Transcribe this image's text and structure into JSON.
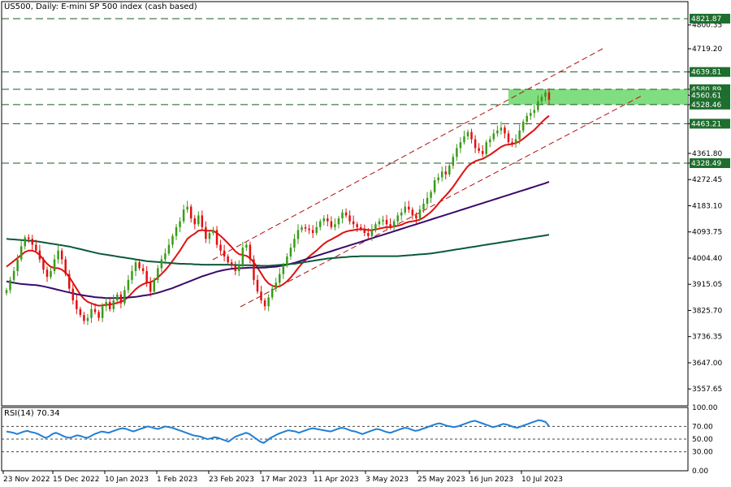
{
  "header": {
    "title": "US500, Daily:  E-mini SP 500 index (cash based)"
  },
  "rsi": {
    "title": "RSI(14) 70.34",
    "levels": [
      30,
      50,
      70
    ],
    "ticks": [
      "100.00",
      "70.00",
      "50.00",
      "30.00",
      "0.00"
    ],
    "values": [
      62,
      61,
      60,
      58,
      60,
      62,
      63,
      61,
      60,
      58,
      55,
      52,
      54,
      58,
      60,
      58,
      55,
      53,
      52,
      54,
      56,
      55,
      53,
      52,
      55,
      58,
      60,
      62,
      61,
      60,
      62,
      64,
      66,
      67,
      66,
      64,
      62,
      64,
      66,
      68,
      70,
      69,
      67,
      66,
      68,
      70,
      69,
      68,
      66,
      64,
      62,
      60,
      58,
      56,
      55,
      54,
      52,
      50,
      51,
      53,
      52,
      50,
      48,
      46,
      50,
      54,
      56,
      58,
      60,
      58,
      54,
      50,
      46,
      44,
      48,
      52,
      55,
      58,
      60,
      62,
      64,
      63,
      62,
      60,
      62,
      64,
      66,
      67,
      66,
      65,
      64,
      63,
      62,
      64,
      66,
      68,
      67,
      65,
      63,
      62,
      60,
      58,
      60,
      62,
      64,
      66,
      65,
      63,
      61,
      60,
      62,
      64,
      66,
      68,
      67,
      65,
      63,
      64,
      66,
      68,
      70,
      72,
      74,
      75,
      73,
      71,
      70,
      69,
      70,
      72,
      74,
      76,
      78,
      79,
      77,
      75,
      73,
      71,
      69,
      70,
      72,
      74,
      73,
      71,
      69,
      68,
      70,
      72,
      74,
      76,
      78,
      80,
      79,
      77,
      70.34
    ]
  },
  "chart_data": {
    "type": "candlestick",
    "title": "US500, Daily:  E-mini SP 500 index (cash based)",
    "ylim": [
      3500,
      4880
    ],
    "y_ticks": [
      "4800.35",
      "4719.20",
      "4639.81",
      "4580.89",
      "4560.61",
      "4528.46",
      "4463.21",
      "4361.80",
      "4328.49",
      "4272.45",
      "4183.10",
      "4093.75",
      "4004.40",
      "3915.05",
      "3825.70",
      "3736.35",
      "3647.00",
      "3557.65"
    ],
    "x_ticks": [
      "23 Nov 2022",
      "15 Dec 2022",
      "10 Jan 2023",
      "1 Feb 2023",
      "23 Feb 2023",
      "17 Mar 2023",
      "11 Apr 2023",
      "3 May 2023",
      "25 May 2023",
      "16 Jun 2023",
      "10 Jul 2023"
    ],
    "price_labels": [
      {
        "value": 4821.87,
        "label": "4821.87"
      },
      {
        "value": 4639.81,
        "label": "4639.81"
      },
      {
        "value": 4580.89,
        "label": "4580.89"
      },
      {
        "value": 4560.61,
        "label": "4560.61"
      },
      {
        "value": 4528.46,
        "label": "4528.46"
      },
      {
        "value": 4463.21,
        "label": "4463.21"
      },
      {
        "value": 4328.49,
        "label": "4328.49"
      }
    ],
    "horizontal_levels": [
      4821.87,
      4639.81,
      4580.89,
      4528.46,
      4463.21,
      4328.49
    ],
    "resistance_zone": [
      4528.46,
      4580.89
    ],
    "closes": [
      3895,
      3930,
      3960,
      4000,
      4045,
      4075,
      4070,
      4050,
      4030,
      4000,
      3965,
      3940,
      3960,
      4000,
      4030,
      4000,
      3950,
      3900,
      3860,
      3830,
      3810,
      3790,
      3800,
      3830,
      3820,
      3800,
      3840,
      3855,
      3830,
      3860,
      3880,
      3850,
      3895,
      3930,
      3960,
      3990,
      3970,
      3960,
      3920,
      3890,
      3930,
      3970,
      4000,
      4020,
      4050,
      4080,
      4110,
      4130,
      4170,
      4180,
      4140,
      4120,
      4150,
      4110,
      4070,
      4090,
      4100,
      4050,
      4030,
      4010,
      3990,
      3980,
      3960,
      3980,
      4040,
      4050,
      4000,
      3930,
      3890,
      3860,
      3840,
      3870,
      3900,
      3920,
      3950,
      3980,
      4010,
      4040,
      4070,
      4100,
      4110,
      4105,
      4100,
      4090,
      4110,
      4130,
      4140,
      4130,
      4110,
      4120,
      4140,
      4160,
      4150,
      4130,
      4120,
      4110,
      4105,
      4090,
      4080,
      4100,
      4120,
      4130,
      4135,
      4120,
      4110,
      4130,
      4150,
      4160,
      4180,
      4170,
      4150,
      4140,
      4170,
      4190,
      4210,
      4230,
      4270,
      4280,
      4300,
      4290,
      4320,
      4350,
      4380,
      4400,
      4420,
      4435,
      4410,
      4380,
      4370,
      4360,
      4400,
      4410,
      4430,
      4440,
      4450,
      4430,
      4400,
      4395,
      4410,
      4440,
      4470,
      4490,
      4500,
      4510,
      4540,
      4555,
      4570,
      4545
    ],
    "series": [
      {
        "name": "",
        "color": "#e01010",
        "values": [
          3975,
          3985,
          3995,
          4005,
          4015,
          4025,
          4030,
          4030,
          4025,
          4015,
          4000,
          3985,
          3975,
          3970,
          3970,
          3965,
          3955,
          3940,
          3920,
          3900,
          3880,
          3865,
          3855,
          3850,
          3845,
          3842,
          3843,
          3845,
          3846,
          3848,
          3852,
          3855,
          3862,
          3872,
          3885,
          3898,
          3908,
          3915,
          3920,
          3922,
          3928,
          3938,
          3950,
          3963,
          3978,
          3995,
          4012,
          4030,
          4050,
          4070,
          4080,
          4088,
          4098,
          4100,
          4098,
          4098,
          4098,
          4090,
          4080,
          4068,
          4055,
          4042,
          4028,
          4018,
          4015,
          4012,
          4004,
          3990,
          3972,
          3952,
          3932,
          3918,
          3910,
          3906,
          3908,
          3915,
          3925,
          3938,
          3953,
          3970,
          3985,
          3998,
          4010,
          4020,
          4030,
          4042,
          4053,
          4062,
          4068,
          4075,
          4082,
          4090,
          4095,
          4098,
          4100,
          4102,
          4103,
          4102,
          4100,
          4100,
          4102,
          4105,
          4108,
          4110,
          4110,
          4112,
          4115,
          4118,
          4124,
          4128,
          4130,
          4132,
          4136,
          4143,
          4152,
          4162,
          4175,
          4190,
          4205,
          4218,
          4232,
          4248,
          4266,
          4284,
          4302,
          4318,
          4328,
          4335,
          4340,
          4343,
          4350,
          4357,
          4366,
          4375,
          4384,
          4390,
          4392,
          4394,
          4397,
          4403,
          4412,
          4422,
          4432,
          4442,
          4455,
          4468,
          4480,
          4490
        ]
      },
      {
        "name": "",
        "color": "#3a0a6a",
        "values": [
          3925,
          3922,
          3920,
          3918,
          3916,
          3915,
          3914,
          3913,
          3912,
          3910,
          3908,
          3905,
          3902,
          3899,
          3896,
          3893,
          3890,
          3887,
          3884,
          3881,
          3879,
          3877,
          3875,
          3873,
          3871,
          3870,
          3869,
          3868,
          3868,
          3868,
          3868,
          3868,
          3869,
          3870,
          3871,
          3872,
          3874,
          3876,
          3878,
          3880,
          3883,
          3886,
          3890,
          3894,
          3898,
          3902,
          3907,
          3912,
          3917,
          3922,
          3927,
          3932,
          3937,
          3942,
          3946,
          3950,
          3954,
          3958,
          3961,
          3964,
          3966,
          3968,
          3969,
          3970,
          3970,
          3971,
          3972,
          3972,
          3972,
          3972,
          3972,
          3973,
          3974,
          3975,
          3977,
          3979,
          3982,
          3985,
          3988,
          3992,
          3996,
          4000,
          4004,
          4008,
          4012,
          4016,
          4020,
          4024,
          4028,
          4032,
          4036,
          4040,
          4044,
          4048,
          4052,
          4056,
          4060,
          4064,
          4068,
          4072,
          4076,
          4080,
          4084,
          4088,
          4092,
          4096,
          4100,
          4104,
          4108,
          4112,
          4116,
          4120,
          4124,
          4128,
          4132,
          4136,
          4140,
          4144,
          4148,
          4152,
          4156,
          4160,
          4164,
          4168,
          4172,
          4176,
          4180,
          4184,
          4188,
          4192,
          4196,
          4200,
          4204,
          4208,
          4212,
          4216,
          4220,
          4224,
          4228,
          4232,
          4236,
          4240,
          4244,
          4248,
          4252,
          4256,
          4260,
          4265
        ]
      },
      {
        "name": "",
        "color": "#0c5a3a",
        "values": [
          4070,
          4069,
          4068,
          4067,
          4066,
          4065,
          4064,
          4063,
          4062,
          4060,
          4058,
          4056,
          4054,
          4052,
          4050,
          4048,
          4046,
          4044,
          4041,
          4038,
          4035,
          4032,
          4029,
          4026,
          4023,
          4020,
          4018,
          4016,
          4014,
          4012,
          4010,
          4008,
          4006,
          4004,
          4002,
          4000,
          3998,
          3996,
          3994,
          3993,
          3992,
          3991,
          3990,
          3989,
          3988,
          3987,
          3986,
          3985,
          3985,
          3984,
          3984,
          3983,
          3983,
          3982,
          3982,
          3982,
          3982,
          3982,
          3982,
          3982,
          3982,
          3981,
          3981,
          3980,
          3980,
          3980,
          3980,
          3979,
          3979,
          3978,
          3978,
          3978,
          3979,
          3980,
          3981,
          3982,
          3983,
          3984,
          3985,
          3987,
          3989,
          3991,
          3993,
          3995,
          3997,
          3999,
          4001,
          4003,
          4004,
          4005,
          4006,
          4007,
          4008,
          4009,
          4010,
          4010,
          4011,
          4011,
          4011,
          4011,
          4011,
          4011,
          4011,
          4011,
          4011,
          4011,
          4011,
          4012,
          4013,
          4014,
          4015,
          4016,
          4017,
          4018,
          4019,
          4020,
          4022,
          4024,
          4026,
          4028,
          4030,
          4032,
          4034,
          4036,
          4038,
          4040,
          4042,
          4044,
          4046,
          4048,
          4050,
          4052,
          4054,
          4056,
          4058,
          4060,
          4062,
          4064,
          4066,
          4068,
          4070,
          4072,
          4074,
          4076,
          4078,
          4080,
          4082,
          4084
        ]
      }
    ]
  },
  "colors": {
    "bull": "#3a9a1a",
    "bear": "#e01010",
    "zone": "#6ad86a",
    "level_line": "#1a5a2a",
    "label_bg": "#1e6e2e",
    "channel": "#b01010",
    "rsi_line": "#1f7fd6"
  }
}
